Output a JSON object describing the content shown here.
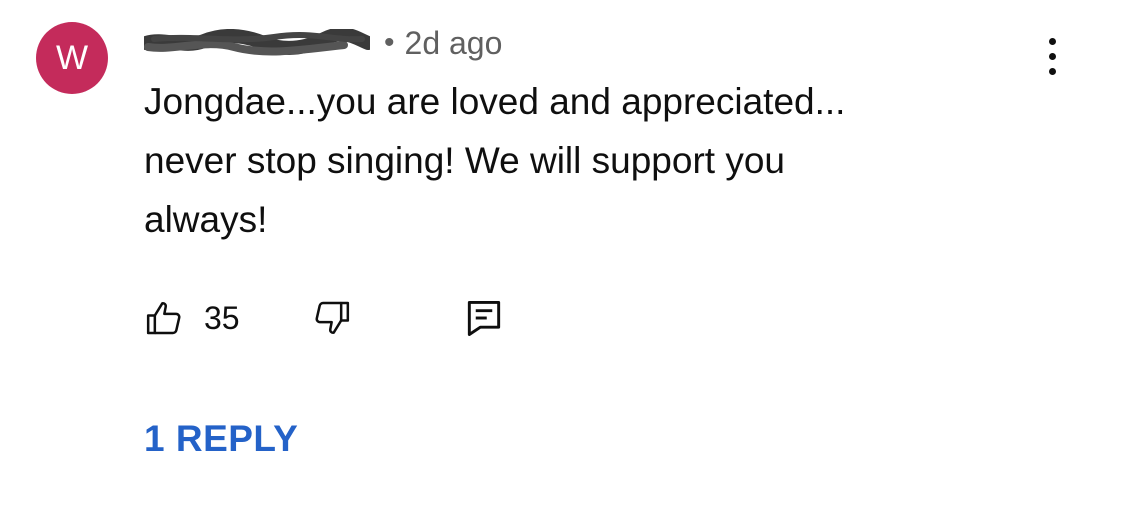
{
  "comment": {
    "avatar_letter": "W",
    "avatar_color": "#c42b5b",
    "timestamp": "2d ago",
    "separator": "•",
    "text": "Jongdae...you are loved and appreciated...\nnever stop singing! We will support you\nalways!",
    "like_count": "35",
    "replies_label": "1 REPLY",
    "replies_color": "#2462c8"
  },
  "icons": {
    "like": "thumbs-up-icon",
    "dislike": "thumbs-down-icon",
    "reply": "comment-reply-icon",
    "more": "more-vertical-icon"
  }
}
